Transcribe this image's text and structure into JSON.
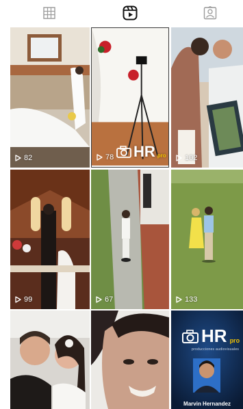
{
  "tabs": [
    {
      "icon": "grid-icon",
      "label": "Posts"
    },
    {
      "icon": "reels-icon",
      "label": "Reels",
      "active": true
    },
    {
      "icon": "tagged-icon",
      "label": "Tagged"
    }
  ],
  "reels": [
    {
      "plays": "82"
    },
    {
      "plays": "78",
      "watermark": "HR",
      "watermark_badge": "pro"
    },
    {
      "plays": "102"
    },
    {
      "plays": "99"
    },
    {
      "plays": "67"
    },
    {
      "plays": "133"
    },
    {
      "plays": ""
    },
    {
      "plays": ""
    },
    {
      "plays": "",
      "promo_logo": "HR",
      "promo_badge": "pro",
      "promo_tagline": "producciones audiovisuales",
      "promo_name": "Marvin Hernandez"
    }
  ],
  "colors": {
    "active_icon": "#111111",
    "inactive_icon": "#9a9a9a",
    "watermark_accent": "#f2c200"
  }
}
